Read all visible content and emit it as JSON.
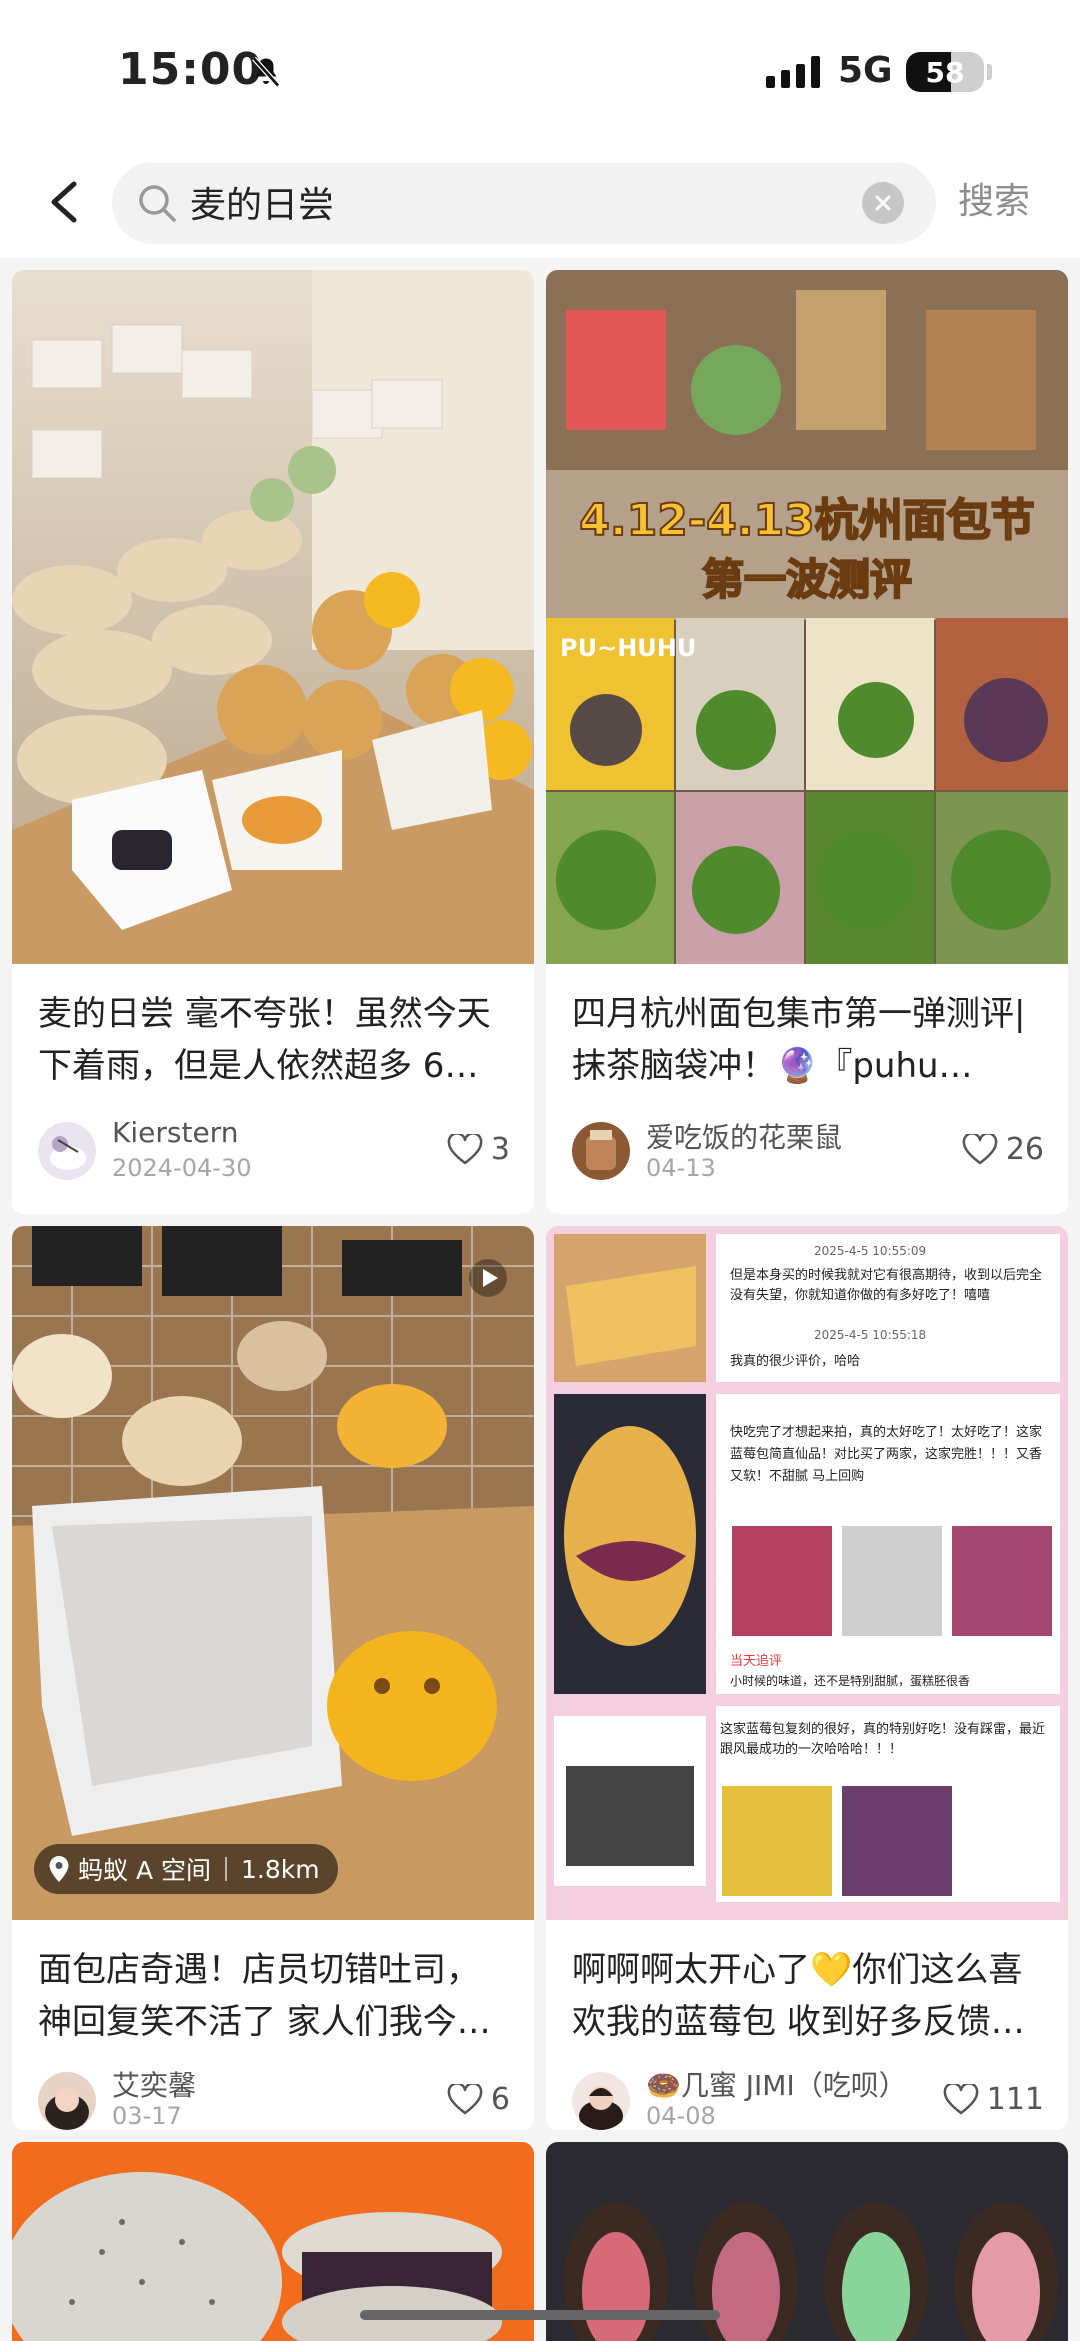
{
  "status": {
    "time": "15:00",
    "network": "5G",
    "battery": "58",
    "battery_level": 0.58
  },
  "search": {
    "query": "麦的日尝",
    "placeholder": "",
    "submit_label": "搜索"
  },
  "posts": [
    {
      "title": "麦的日尝 毫不夸张！虽然今天下着雨，但是人依然超多 6…",
      "author": "Kierstern",
      "date": "2024-04-30",
      "likes": "3"
    },
    {
      "title": "四月杭州面包集市第一弹测评|抹茶脑袋冲！🔮『puhu…",
      "author": "爱吃饭的花栗鼠",
      "date": "04-13",
      "likes": "26",
      "cover_text": {
        "headline_1": "4.12-4.13杭州面包节",
        "headline_2": "第一波测评",
        "tag": "PU~HUHU"
      }
    },
    {
      "title": "面包店奇遇！店员切错吐司，神回复笑不活了 家人们我今…",
      "author": "艾奕馨",
      "date": "03-17",
      "likes": "6",
      "location": {
        "name": "蚂蚁 A 空间",
        "distance": "1.8km"
      }
    },
    {
      "title": "啊啊啊太开心了💛你们这么喜欢我的蓝莓包 收到好多反馈…",
      "author": "🍩几蜜 JIMI（吃呗）",
      "date": "04-08",
      "likes": "111",
      "cover_text": {
        "review_1_time": "2025-4-5 10:55:09",
        "review_1_text": "但是本身买的时候我就对它有很高期待，收到以后完全没有失望，你就知道你做的有多好吃了！嘻嘻",
        "review_2_time": "2025-4-5 10:55:18",
        "review_2_text": "我真的很少评价，哈哈",
        "review_3_text": "快吃完了才想起来拍，真的太好吃了！太好吃了！这家蓝莓包简直仙品！对比买了两家，这家完胜！！！又香又软！不甜腻 马上回购",
        "review_4_label": "当天追评",
        "review_4_text": "小时候的味道，还不是特别甜腻，蛋糕胚很香",
        "review_5_text": "这家蓝莓包复刻的很好，真的特别好吃！没有踩雷，最近跟风最成功的一次哈哈哈！！！"
      }
    },
    {
      "title": "",
      "author": "",
      "date": "",
      "likes": ""
    },
    {
      "title": "",
      "author": "",
      "date": "",
      "likes": ""
    }
  ]
}
